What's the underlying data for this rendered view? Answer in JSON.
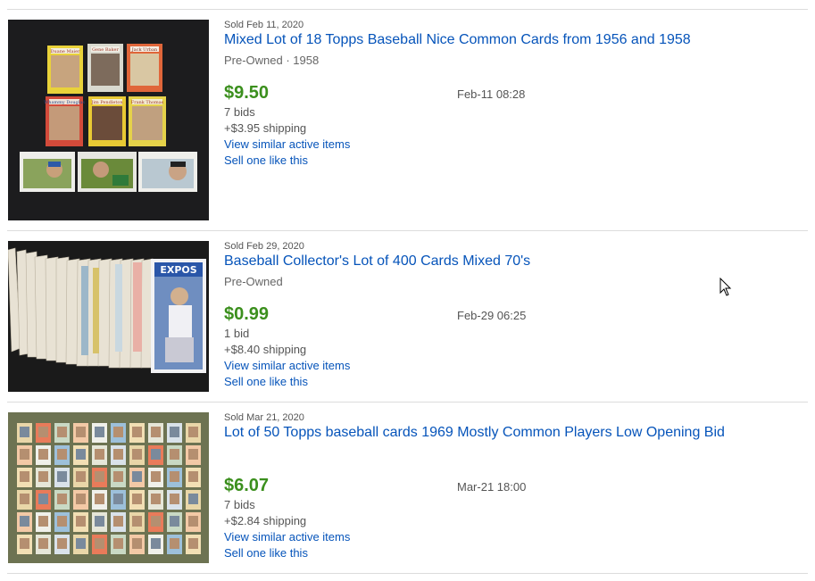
{
  "listings": [
    {
      "sold_date": "Sold Feb 11, 2020",
      "title": "Mixed Lot of 18 Topps Baseball Nice Common Cards from 1956 and 1958",
      "condition": "Pre-Owned · 1958",
      "price": "$9.50",
      "bids": "7 bids",
      "shipping": "+$3.95 shipping",
      "end_time": "Feb-11 08:28",
      "view_similar": "View similar active items",
      "sell_one": "Sell one like this",
      "card_names": [
        "Duane Maier",
        "Gene Baker",
        "Jack Urban",
        "Whammy Douglas",
        "Jim Pendleton",
        "Frank Thomas"
      ]
    },
    {
      "sold_date": "Sold Feb 29, 2020",
      "title": "Baseball Collector's Lot of 400 Cards Mixed 70's",
      "condition": "Pre-Owned",
      "price": "$0.99",
      "bids": "1 bid",
      "shipping": "+$8.40 shipping",
      "end_time": "Feb-29 06:25",
      "view_similar": "View similar active items",
      "sell_one": "Sell one like this",
      "card_team": "EXPOS"
    },
    {
      "sold_date": "Sold Mar 21, 2020",
      "title": "Lot of 50 Topps baseball cards 1969 Mostly Common Players Low Opening Bid",
      "condition": "",
      "price": "$6.07",
      "bids": "7 bids",
      "shipping": "+$2.84 shipping",
      "end_time": "Mar-21 18:00",
      "view_similar": "View similar active items",
      "sell_one": "Sell one like this"
    }
  ],
  "colors": {
    "link": "#0654ba",
    "price": "#3b8f1d",
    "meta": "#555555",
    "rule": "#dcdcdc"
  }
}
